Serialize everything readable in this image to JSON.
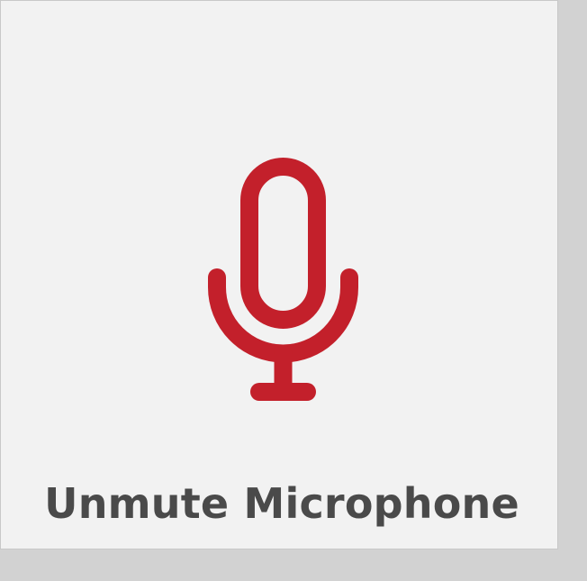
{
  "tile": {
    "label": "Unmute Microphone",
    "icon": "microphone-icon",
    "icon_color": "#c3202b",
    "label_color": "#4a4a4a",
    "background_color": "#f2f2f2"
  }
}
